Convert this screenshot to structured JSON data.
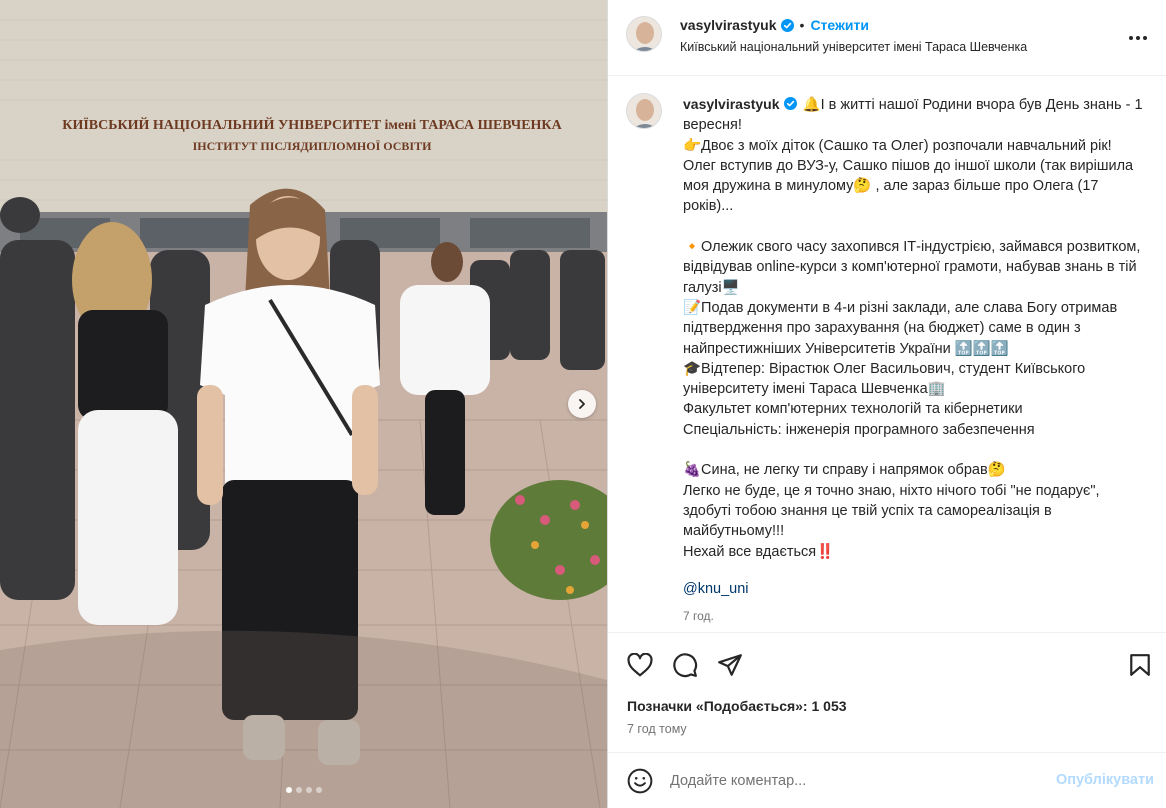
{
  "photo": {
    "sign_line1": "КИЇВСЬКИЙ НАЦІОНАЛЬНИЙ УНІВЕРСИТЕТ імені ТАРАСА ШЕВЧЕНКА",
    "sign_line2": "ІНСТИТУТ ПІСЛЯДИПЛОМНОЇ ОСВІТИ",
    "carousel_total": 4,
    "carousel_active": 1
  },
  "header": {
    "username": "vasylvirastyuk",
    "separator": "•",
    "follow_label": "Стежити",
    "location": "Київський національний університет імені Тараса Шевченка"
  },
  "caption": {
    "username": "vasylvirastyuk",
    "text": "🔔І в житті нашої Родини вчора був День знань - 1 вересня!\n👉Двоє з моїх діток (Сашко та Олег) розпочали навчальний рік! Олег вступив до ВУЗ-у, Сашко пішов до іншої школи (так вирішила моя дружина в минулому🤔 , але зараз більше про Олега (17 років)...\n\n🔸Олежик свого часу захопився ІТ-індустрією, займався розвитком, відвідував online-курси з комп'ютерної грамоти, набував знань в тій галузі🖥️\n📝Подав документи в 4-и різні заклади, але слава Богу отримав підтвердження про зарахування (на бюджет) саме в один з найпрестижніших Університетів України 🔝🔝🔝\n🎓Відтепер: Вірастюк Олег Васильович, студент Київського університету імені Тараса Шевченка🏢\nФакультет комп'ютерних технологій та кібернетики\nСпеціальність: інженерія програмного забезпечення\n\n🍇Сина, не легку ти справу і напрямок обрав🤔\nЛегко не буде, це я точно знаю, ніхто нічого тобі \"не подарує\", здобуті тобою знання це твій успіх та самореалізація в майбутньому!!!\nНехай все вдається‼️",
    "mention": "@knu_uni",
    "time": "7 год."
  },
  "actions": {
    "like_icon": "heart-icon",
    "comment_icon": "comment-icon",
    "share_icon": "send-icon",
    "save_icon": "bookmark-icon"
  },
  "stats": {
    "likes": "Позначки «Подобається»: 1 053",
    "time": "7 год тому"
  },
  "comment": {
    "placeholder": "Додайте коментар...",
    "publish_label": "Опублікувати"
  },
  "colors": {
    "link_blue": "#0095f6",
    "mention_blue": "#00376b",
    "publish_disabled": "#b3dbff",
    "verified_blue": "#0095f6",
    "secondary_text": "#737373"
  }
}
